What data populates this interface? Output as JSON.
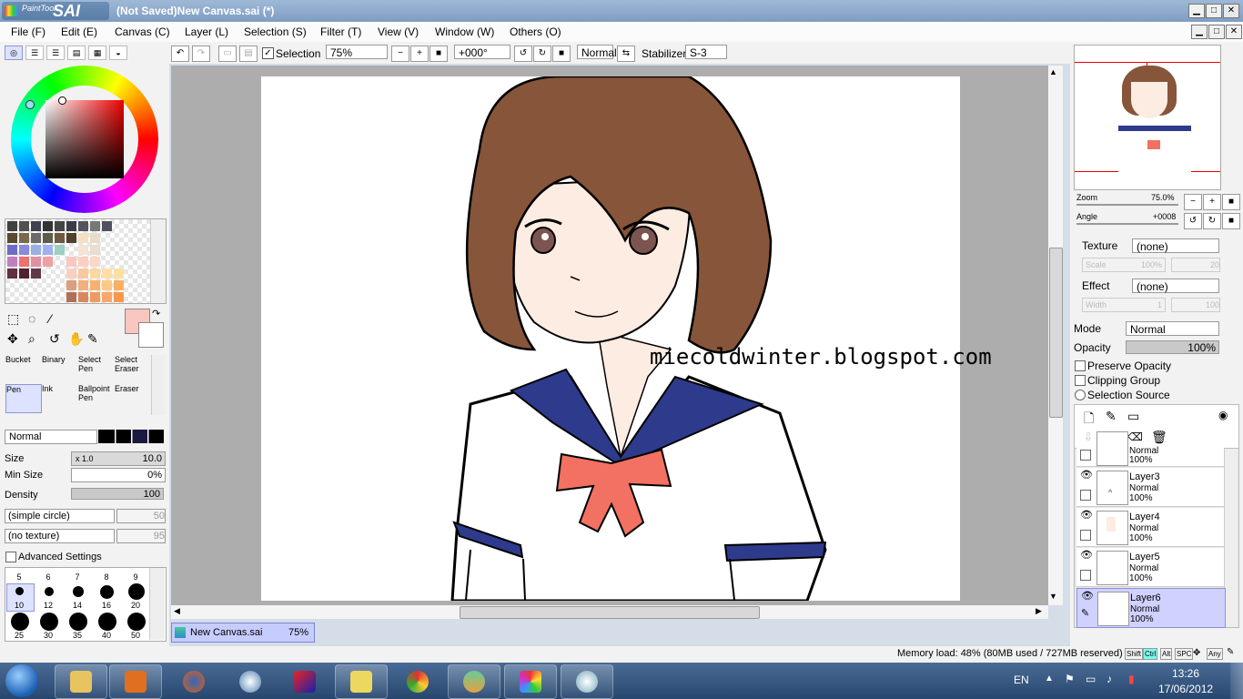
{
  "app": {
    "logo_small": "PaintTool",
    "logo_big": "SAI",
    "title": "(Not Saved)New Canvas.sai (*)"
  },
  "window_buttons": {
    "minimize": "▁",
    "maximize": "□",
    "close": "✕"
  },
  "menu": [
    "File (F)",
    "Edit (E)",
    "Canvas (C)",
    "Layer (L)",
    "Selection (S)",
    "Filter (T)",
    "View (V)",
    "Window (W)",
    "Others (O)"
  ],
  "toolbar": {
    "selection_label": "Selection",
    "zoom": "75%",
    "angle": "+000°",
    "mode": "Normal",
    "stabilizer_label": "Stabilizer",
    "stabilizer": "S-3"
  },
  "tools": [
    {
      "label": "Bucket"
    },
    {
      "label": "Binary"
    },
    {
      "label": "Select Pen"
    },
    {
      "label": "Select Eraser"
    },
    {
      "label": "Pen"
    },
    {
      "label": "Ink"
    },
    {
      "label": "Ballpoint Pen"
    },
    {
      "label": "Eraser"
    }
  ],
  "brush": {
    "blend_mode": "Normal",
    "size_label": "Size",
    "size_mult": "x 1.0",
    "size_value": "10.0",
    "min_size_label": "Min Size",
    "min_size_value": "0%",
    "density_label": "Density",
    "density_value": "100",
    "shape": "(simple circle)",
    "shape_value": "50",
    "texture": "(no texture)",
    "texture_value": "95",
    "advanced_label": "Advanced Settings",
    "sizes": [
      "5",
      "6",
      "7",
      "8",
      "9",
      "10",
      "12",
      "14",
      "16",
      "20",
      "25",
      "30",
      "35",
      "40",
      "50"
    ]
  },
  "canvas": {
    "watermark": "miecoldwinter.blogspot.com"
  },
  "navigator": {
    "zoom_label": "Zoom",
    "zoom_value": "75.0%",
    "angle_label": "Angle",
    "angle_value": "+0008"
  },
  "layer_panel": {
    "texture_label": "Texture",
    "texture_value": "(none)",
    "scale_label": "Scale",
    "scale_value": "100%",
    "scale_value2": "20",
    "effect_label": "Effect",
    "effect_value": "(none)",
    "width_label": "Width",
    "width_value": "1",
    "width_value2": "100",
    "mode_label": "Mode",
    "mode_value": "Normal",
    "opacity_label": "Opacity",
    "opacity_value": "100%",
    "preserve_opacity": "Preserve Opacity",
    "clipping_group": "Clipping Group",
    "selection_source": "Selection Source"
  },
  "layers": [
    {
      "name": "",
      "mode": "Normal",
      "opacity": "100%"
    },
    {
      "name": "Layer3",
      "mode": "Normal",
      "opacity": "100%"
    },
    {
      "name": "Layer4",
      "mode": "Normal",
      "opacity": "100%"
    },
    {
      "name": "Layer5",
      "mode": "Normal",
      "opacity": "100%"
    },
    {
      "name": "Layer6",
      "mode": "Normal",
      "opacity": "100%",
      "selected": true
    }
  ],
  "document_tab": {
    "name": "New Canvas.sai",
    "zoom": "75%"
  },
  "status": {
    "memory": "Memory load: 48% (80MB used / 727MB reserved)",
    "keys": [
      "Shift",
      "Ctrl",
      "Alt",
      "SPC",
      "Any"
    ]
  },
  "taskbar": {
    "lang": "EN",
    "time": "13:26",
    "date": "17/06/2012"
  },
  "colors": {
    "accent_selection": "#cfd1ff",
    "title_bar": "#8aa6cb",
    "taskbar": "#35547d"
  }
}
